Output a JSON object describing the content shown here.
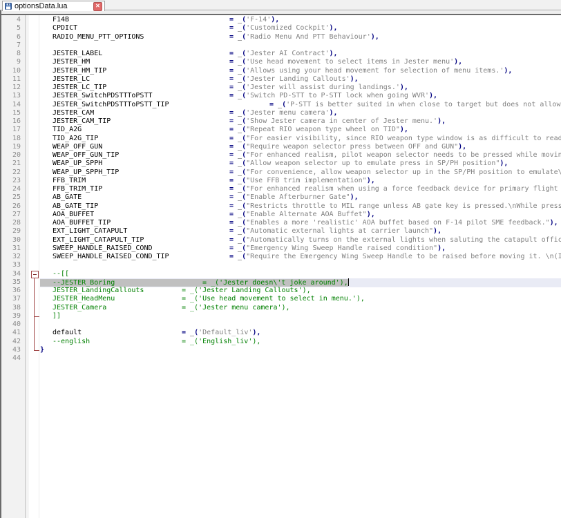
{
  "tab_bar": {
    "tabs": [
      {
        "title": "optionsData.lua",
        "active": true,
        "state_icon": "saved-floppy-icon",
        "close_icon": "close-x-icon"
      }
    ]
  },
  "ui_colors": {
    "close": "#e26868",
    "floppy": "#3f6fb5",
    "floppydark": "#2d4f86",
    "border": "#6b6b6b"
  },
  "editor": {
    "language": "lua",
    "first_line": 4,
    "last_line": 44,
    "caret_line": 35,
    "colors": {
      "identifier": "#000000",
      "operator": "#000080",
      "string": "#808080",
      "comment": "#008000",
      "linenum": "#8c8c8c",
      "selbg": "#c0c0c0",
      "cline": "#e9ebf5",
      "fold": "#a04545",
      "marginbg": "#f2f2f2"
    },
    "fold": {
      "box_line": 34,
      "line_to": 43,
      "ticks": [
        39,
        43
      ]
    },
    "lines": [
      {
        "n": 4,
        "key": "F14B",
        "kw": 256,
        "q": "'",
        "s": "F-14",
        "end": true
      },
      {
        "n": 5,
        "key": "CPDICT",
        "kw": 256,
        "q": "'",
        "s": "Customized Cockpit",
        "end": true
      },
      {
        "n": 6,
        "key": "RADIO_MENU_PTT_OPTIONS",
        "kw": 256,
        "q": "'",
        "s": "Radio Menu And PTT Behaviour",
        "end": true
      },
      {
        "n": 7
      },
      {
        "n": 8,
        "key": "JESTER_LABEL",
        "kw": 256,
        "q": "'",
        "s": "Jester AI Contract",
        "end": true
      },
      {
        "n": 9,
        "key": "JESTER_HM",
        "kw": 256,
        "q": "'",
        "s": "Use head movement to select items in Jester menu",
        "end": true
      },
      {
        "n": 10,
        "key": "JESTER_HM_TIP",
        "kw": 256,
        "q": "'",
        "s": "Allows using your head movement for selection of menu items.",
        "end": true
      },
      {
        "n": 11,
        "key": "JESTER_LC",
        "kw": 256,
        "q": "'",
        "s": "Jester Landing Callouts",
        "end": true
      },
      {
        "n": 12,
        "key": "JESTER_LC_TIP",
        "kw": 256,
        "q": "'",
        "s": "Jester will assist during landings.",
        "end": true
      },
      {
        "n": 13,
        "key": "JESTER_SwitchPDSTTToPSTT",
        "kw": 256,
        "q": "'",
        "s": "Switch PD-STT to P-STT lock when going WVR",
        "end": true
      },
      {
        "n": 14,
        "key": "JESTER_SwitchPDSTTToPSTT_TIP",
        "kw": 314,
        "q": "'",
        "s": "P-STT is better suited in when close to target but does not allow AIM",
        "end": false
      },
      {
        "n": 15,
        "key": "JESTER_CAM",
        "kw": 256,
        "q": "'",
        "s": "Jester menu camera",
        "end": true
      },
      {
        "n": 16,
        "key": "JESTER_CAM_TIP",
        "kw": 256,
        "q": "'",
        "s": "Show Jester camera in center of Jester menu.",
        "end": true
      },
      {
        "n": 17,
        "key": "TID_A2G",
        "kw": 256,
        "q": "\"",
        "s": "Repeat RIO weapon type wheel on TID",
        "end": true
      },
      {
        "n": 18,
        "key": "TID_A2G_TIP",
        "kw": 256,
        "q": "\"",
        "s": "For easier visibility, since RIO weapon type window is as difficult to read\\nin-",
        "end": false
      },
      {
        "n": 19,
        "key": "WEAP_OFF_GUN",
        "kw": 256,
        "q": "\"",
        "s": "Require weapon selector press between OFF and GUN",
        "end": true
      },
      {
        "n": 20,
        "key": "WEAP_OFF_GUN_TIP",
        "kw": 256,
        "q": "\"",
        "s": "For enhanced realism, pilot weapon selector needs to be pressed while moving\\nbe",
        "end": false
      },
      {
        "n": 21,
        "key": "WEAP_UP_SPPH",
        "kw": 256,
        "q": "\"",
        "s": "Allow weapon selector up to emulate press in SP/PH position",
        "end": true
      },
      {
        "n": 22,
        "key": "WEAP_UP_SPPH_TIP",
        "kw": 256,
        "q": "\"",
        "s": "For convenience, allow weapon selector up in the SP/PH position to emulate\\nweap",
        "end": false
      },
      {
        "n": 23,
        "key": "FFB_TRIM",
        "kw": 256,
        "q": "\"",
        "s": "Use FFB trim implementation",
        "end": true
      },
      {
        "n": 24,
        "key": "FFB_TRIM_TIP",
        "kw": 256,
        "q": "\"",
        "s": "For enhanced realism when using a force feedback device for primary flight contr",
        "end": false
      },
      {
        "n": 25,
        "key": "AB_GATE",
        "kw": 256,
        "q": "\"",
        "s": "Enable Afterburner Gate",
        "end": true
      },
      {
        "n": 26,
        "key": "AB_GATE_TIP",
        "kw": 256,
        "q": "\"",
        "s": "Restricts throttle to MIL range unless AB gate key is pressed.\\nWhile pressed, f",
        "end": false
      },
      {
        "n": 27,
        "key": "AOA_BUFFET",
        "kw": 256,
        "q": "\"",
        "s": "Enable Alternate AOA Buffet",
        "end": true
      },
      {
        "n": 28,
        "key": "AOA_BUFFET_TIP",
        "kw": 256,
        "q": "\"",
        "s": "Enables a more 'realistic' AOA buffet based on F-14 pilot SME feedback.",
        "end": true
      },
      {
        "n": 29,
        "key": "EXT_LIGHT_CATAPULT",
        "kw": 256,
        "q": "\"",
        "s": "Automatic external lights at carrier launch",
        "end": true
      },
      {
        "n": 30,
        "key": "EXT_LIGHT_CATAPULT_TIP",
        "kw": 256,
        "q": "\"",
        "s": "Automatically turns on the external lights when saluting the catapult officer at",
        "end": false
      },
      {
        "n": 31,
        "key": "SWEEP_HANDLE_RAISED_COND",
        "kw": 256,
        "q": "\"",
        "s": "Emergency Wing Sweep Handle raised condition",
        "end": true
      },
      {
        "n": 32,
        "key": "SWEEP_HANDLE_RAISED_COND_TIP",
        "kw": 256,
        "q": "\"",
        "s": "Require the Emergency Wing Sweep Handle to be raised before moving it. \\n(In rea",
        "end": false
      },
      {
        "n": 33
      },
      {
        "n": 34,
        "raw": "--[[",
        "c": "com"
      },
      {
        "n": 35,
        "caret": true,
        "sel": {
          "indent": 18,
          "key": "--JESTER_Boring",
          "kw": 217,
          "val": "= _('Jester doesn\\'t joke around'),"
        }
      },
      {
        "n": 36,
        "ckey": "JESTER_LandingCallouts",
        "kw": 187,
        "cval": "= _('Jester Landing Callouts'),"
      },
      {
        "n": 37,
        "ckey": "JESTER_HeadMenu",
        "kw": 187,
        "cval": "= _('Use head movement to select in menu.'),"
      },
      {
        "n": 38,
        "ckey": "JESTER_Camera",
        "kw": 187,
        "cval": "= _('Jester menu camera'),"
      },
      {
        "n": 39,
        "raw": "]]",
        "c": "com"
      },
      {
        "n": 40
      },
      {
        "n": 41,
        "key": "default",
        "kw": 187,
        "q": "'",
        "s": "Default_liv",
        "end": true
      },
      {
        "n": 42,
        "ckey": "--english",
        "kw": 187,
        "cval": "= _('English_liv'),"
      },
      {
        "n": 43,
        "x": 58,
        "raw": "}",
        "c": "op"
      },
      {
        "n": 44
      }
    ]
  }
}
